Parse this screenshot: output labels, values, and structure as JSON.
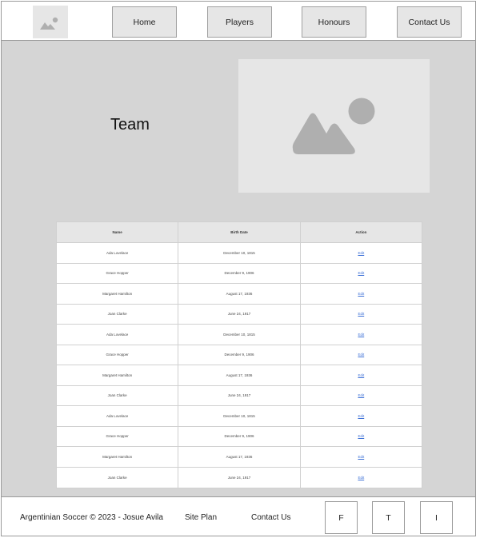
{
  "header": {
    "logo_icon": "image-placeholder-icon",
    "nav": [
      {
        "label": "Home"
      },
      {
        "label": "Players"
      },
      {
        "label": "Honours"
      },
      {
        "label": "Contact Us"
      }
    ]
  },
  "hero": {
    "title": "Team",
    "image_icon": "image-placeholder-icon"
  },
  "table": {
    "headers": [
      "Name",
      "Birth Date",
      "Action"
    ],
    "rows": [
      {
        "name": "Ada Lovelace",
        "birth": "December 10, 1815",
        "action": "Edit"
      },
      {
        "name": "Grace Hopper",
        "birth": "December 9, 1906",
        "action": "Edit"
      },
      {
        "name": "Margaret Hamilton",
        "birth": "August 17, 1936",
        "action": "Edit"
      },
      {
        "name": "Joan Clarke",
        "birth": "June 24, 1917",
        "action": "Edit"
      },
      {
        "name": "Ada Lovelace",
        "birth": "December 10, 1815",
        "action": "Edit"
      },
      {
        "name": "Grace Hopper",
        "birth": "December 9, 1906",
        "action": "Edit"
      },
      {
        "name": "Margaret Hamilton",
        "birth": "August 17, 1936",
        "action": "Edit"
      },
      {
        "name": "Joan Clarke",
        "birth": "June 24, 1917",
        "action": "Edit"
      },
      {
        "name": "Ada Lovelace",
        "birth": "December 10, 1815",
        "action": "Edit"
      },
      {
        "name": "Grace Hopper",
        "birth": "December 9, 1906",
        "action": "Edit"
      },
      {
        "name": "Margaret Hamilton",
        "birth": "August 17, 1936",
        "action": "Edit"
      },
      {
        "name": "Joan Clarke",
        "birth": "June 24, 1917",
        "action": "Edit"
      }
    ]
  },
  "footer": {
    "copyright": "Argentinian Soccer © 2023 - Josue Avila",
    "site_plan": "Site Plan",
    "contact": "Contact Us",
    "social": [
      {
        "label": "F"
      },
      {
        "label": "T"
      },
      {
        "label": "I"
      }
    ]
  },
  "colors": {
    "page_background": "#d5d5d5",
    "panel": "#ffffff",
    "placeholder": "#e6e6e6",
    "placeholder_shape": "#afafaf",
    "link": "#3b6fd6"
  }
}
